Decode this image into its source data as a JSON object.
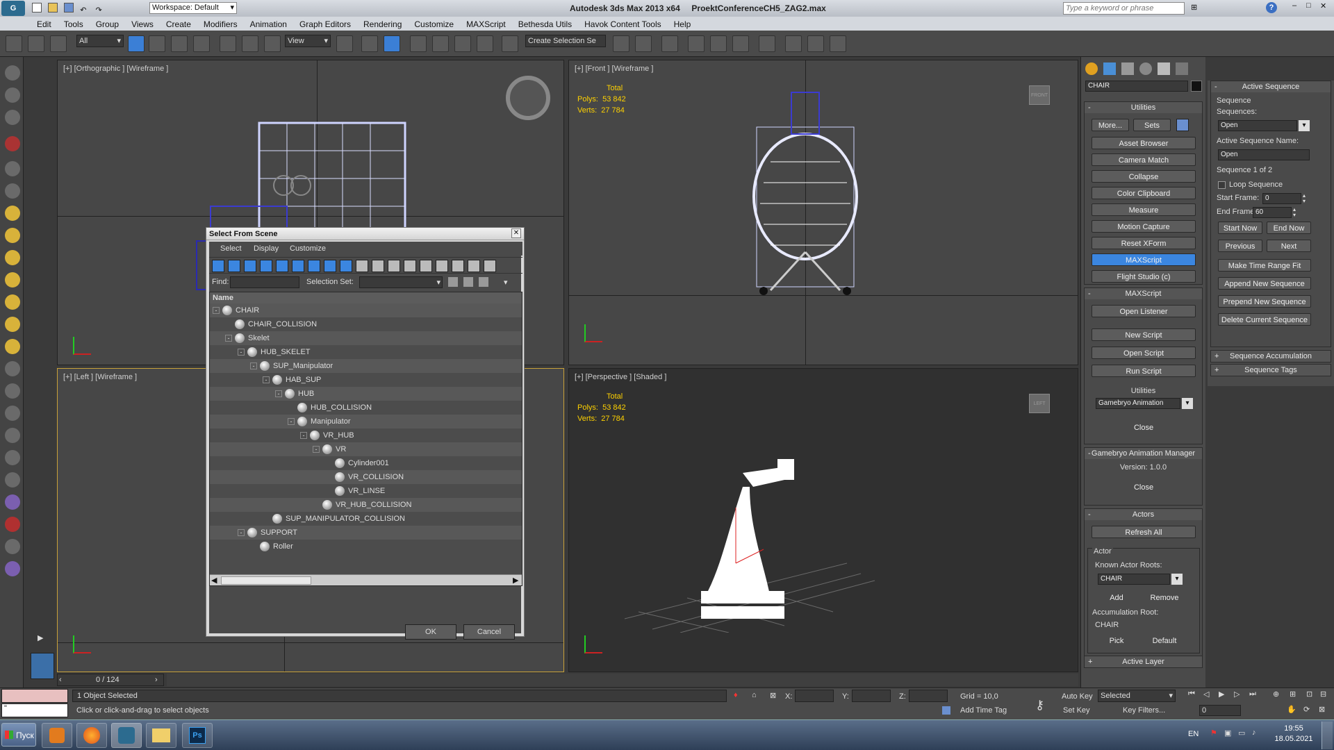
{
  "app": {
    "title": "Autodesk 3ds Max  2013 x64",
    "file": "ProektConferenceCH5_ZAG2.max",
    "workspace": "Workspace: Default",
    "search_placeholder": "Type a keyword or phrase"
  },
  "menu": [
    "Edit",
    "Tools",
    "Group",
    "Views",
    "Create",
    "Modifiers",
    "Animation",
    "Graph Editors",
    "Rendering",
    "Customize",
    "MAXScript",
    "Bethesda Utils",
    "Havok Content Tools",
    "Help"
  ],
  "toolbar": {
    "filter": "All",
    "refcoord": "View",
    "selection_set": "Create Selection Se"
  },
  "viewports": {
    "top_left": {
      "label": "[+] [Orthographic ] [Wireframe ]"
    },
    "top_right": {
      "label": "[+] [Front ] [Wireframe ]",
      "total": "Total",
      "polys_label": "Polys:",
      "polys": "53 842",
      "verts_label": "Verts:",
      "verts": "27 784",
      "cube": "FRONT"
    },
    "bottom_left": {
      "label": "[+] [Left ] [Wireframe ]"
    },
    "bottom_right": {
      "label": "[+] [Perspective ] [Shaded ]",
      "total": "Total",
      "polys_label": "Polys:",
      "polys": "53 842",
      "verts_label": "Verts:",
      "verts": "27 784",
      "cube": "LEFT"
    }
  },
  "dialog": {
    "title": "Select From Scene",
    "menus": [
      "Select",
      "Display",
      "Customize"
    ],
    "find_label": "Find:",
    "selset_label": "Selection Set:",
    "column": "Name",
    "ok": "OK",
    "cancel": "Cancel",
    "tree": [
      {
        "name": "CHAIR",
        "exp": "-"
      },
      {
        "name": "CHAIR_COLLISION",
        "exp": ""
      },
      {
        "name": "Skelet",
        "exp": "-"
      },
      {
        "name": "HUB_SKELET",
        "exp": "-"
      },
      {
        "name": "SUP_Manipulator",
        "exp": "-"
      },
      {
        "name": "HAB_SUP",
        "exp": "-"
      },
      {
        "name": "HUB",
        "exp": "-"
      },
      {
        "name": "HUB_COLLISION",
        "exp": ""
      },
      {
        "name": "Manipulator",
        "exp": "-"
      },
      {
        "name": "VR_HUB",
        "exp": "-"
      },
      {
        "name": "VR",
        "exp": "-"
      },
      {
        "name": "Cylinder001",
        "exp": ""
      },
      {
        "name": "VR_COLLISION",
        "exp": ""
      },
      {
        "name": "VR_LINSE",
        "exp": ""
      },
      {
        "name": "VR_HUB_COLLISION",
        "exp": ""
      },
      {
        "name": "SUP_MANIPULATOR_COLLISION",
        "exp": ""
      },
      {
        "name": "SUPPORT",
        "exp": "-"
      },
      {
        "name": "Roller",
        "exp": ""
      }
    ]
  },
  "command_panel": {
    "object_name": "CHAIR",
    "utilities_title": "Utilities",
    "more": "More...",
    "sets": "Sets",
    "buttons": [
      "Asset Browser",
      "Camera Match",
      "Collapse",
      "Color Clipboard",
      "Measure",
      "Motion Capture",
      "Reset XForm",
      "MAXScript",
      "Flight Studio (c)"
    ],
    "maxscript_title": "MAXScript",
    "open_listener": "Open Listener",
    "new_script": "New Script",
    "open_script": "Open Script",
    "run_script": "Run Script",
    "utilities_label": "Utilities",
    "utility_select": "Gamebryo Animation",
    "close": "Close",
    "gamebryo_title": "Gamebryo Animation Manager",
    "version": "Version: 1.0.0",
    "close2": "Close",
    "actors_title": "Actors",
    "refresh_all": "Refresh All",
    "actor_group": "Actor",
    "known_roots": "Known Actor Roots:",
    "actor_root": "CHAIR",
    "add": "Add",
    "remove": "Remove",
    "accum_root_label": "Accumulation Root:",
    "accum_root": "CHAIR",
    "pick": "Pick",
    "default": "Default",
    "active_layer": "Active Layer"
  },
  "sequence_panel": {
    "title": "Active Sequence",
    "sequence_group": "Sequence",
    "sequences_label": "Sequences:",
    "sequence_value": "Open",
    "name_label": "Active Sequence Name:",
    "name_value": "Open",
    "counter": "Sequence 1 of 2",
    "loop": "Loop Sequence",
    "start_label": "Start Frame:",
    "start": "0",
    "end_label": "End Frame:",
    "end": "60",
    "start_now": "Start Now",
    "end_now": "End Now",
    "previous": "Previous",
    "next": "Next",
    "make_range": "Make Time Range Fit",
    "append": "Append New Sequence",
    "prepend": "Prepend New Sequence",
    "delete": "Delete Current Sequence",
    "accumulation": "Sequence Accumulation",
    "tags": "Sequence Tags"
  },
  "status": {
    "timeslider": "0 / 124",
    "selected": "1 Object Selected",
    "prompt": "Click or click-and-drag to select objects",
    "x": "X:",
    "y": "Y:",
    "z": "Z:",
    "grid": "Grid = 10,0",
    "autokey": "Auto Key",
    "selected_dd": "Selected",
    "setkey": "Set Key",
    "keyfilters": "Key Filters...",
    "frame": "0",
    "add_time_tag": "Add Time Tag"
  },
  "taskbar": {
    "start": "Пуск",
    "lang": "EN",
    "time": "19:55",
    "date": "18.05.2021"
  }
}
